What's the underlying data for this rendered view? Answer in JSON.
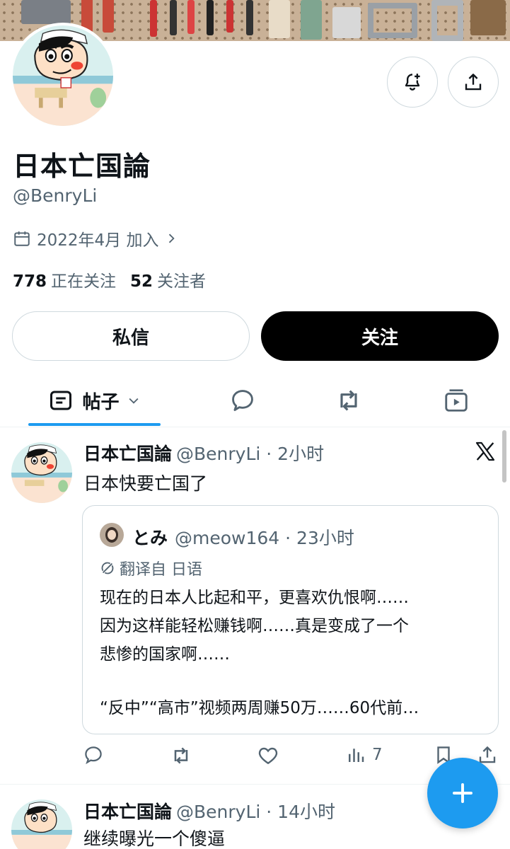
{
  "profile": {
    "display_name": "日本亡国論",
    "handle": "@BenryLi",
    "joined": "2022年4月 加入",
    "following_count": "778",
    "following_label": "正在关注",
    "followers_count": "52",
    "followers_label": "关注者"
  },
  "buttons": {
    "message": "私信",
    "follow": "关注"
  },
  "tabs": {
    "posts": "帖子"
  },
  "posts": [
    {
      "name": "日本亡国論",
      "meta": "@BenryLi · 2小时",
      "text": "日本快要亡国了",
      "quote": {
        "name": "とみ",
        "meta": "@meow164 · 23小时",
        "translate": "翻译自 日语",
        "lines": [
          "现在的日本人比起和平，更喜欢仇恨啊……",
          "因为这样能轻松赚钱啊……真是变成了一个",
          "悲惨的国家啊……",
          "“反中”“高市”视频两周赚50万……60代前…"
        ]
      },
      "views": "7"
    },
    {
      "name": "日本亡国論",
      "meta": "@BenryLi · 14小时",
      "text": "继续曝光一个傻逼"
    }
  ],
  "icons": {
    "notify": "bell-plus-icon",
    "share": "share-icon",
    "calendar": "calendar-icon",
    "accent": "#1d9bf0"
  }
}
